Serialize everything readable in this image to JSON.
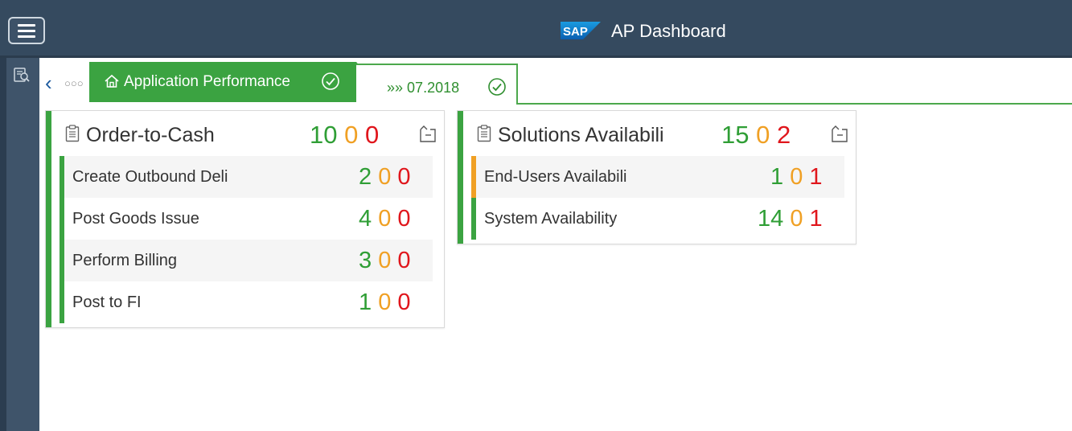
{
  "shell": {
    "title": "AP Dashboard",
    "logo_text": "SAP",
    "menu_icon": "hamburger-menu-icon"
  },
  "sidebar": {
    "icon": "search-document-icon"
  },
  "breadcrumb": {
    "back_icon": "chevron-left-icon",
    "overflow": "○○○",
    "active_label": "Application Performance",
    "date_prefix": "»»",
    "date_label": "07.2018"
  },
  "colors": {
    "ok": "#2f9e35",
    "warning": "#f0a024",
    "critical": "#e0161c",
    "shell": "#354a5f"
  },
  "tiles": [
    {
      "title": "Order-to-Cash",
      "counts": {
        "green": "10",
        "orange": "0",
        "red": "0"
      },
      "rows": [
        {
          "label": "Create Outbound Deli",
          "green": "2",
          "orange": "0",
          "red": "0",
          "status": "ok"
        },
        {
          "label": "Post Goods Issue",
          "green": "4",
          "orange": "0",
          "red": "0",
          "status": "ok"
        },
        {
          "label": "Perform Billing",
          "green": "3",
          "orange": "0",
          "red": "0",
          "status": "ok"
        },
        {
          "label": "Post to FI",
          "green": "1",
          "orange": "0",
          "red": "0",
          "status": "ok"
        }
      ]
    },
    {
      "title": "Solutions Availabili",
      "counts": {
        "green": "15",
        "orange": "0",
        "red": "2"
      },
      "rows": [
        {
          "label": "End-Users Availabili",
          "green": "1",
          "orange": "0",
          "red": "1",
          "status": "warning"
        },
        {
          "label": "System Availability",
          "green": "14",
          "orange": "0",
          "red": "1",
          "status": "ok"
        }
      ]
    }
  ]
}
